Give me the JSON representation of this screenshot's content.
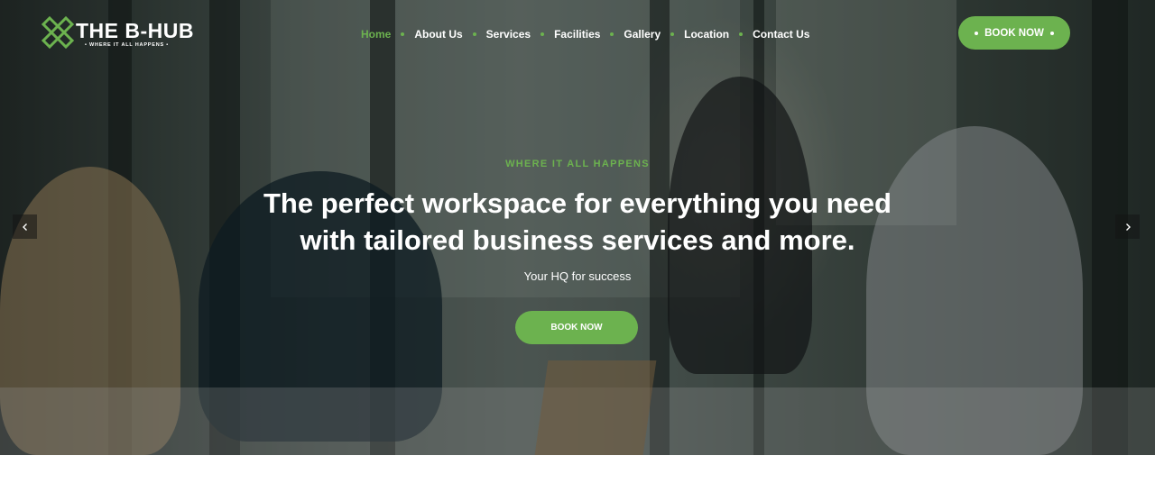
{
  "brand": {
    "name": "THE B-HUB",
    "tagline": "• WHERE IT ALL HAPPENS •",
    "accent_color": "#6cb24f"
  },
  "nav": {
    "items": [
      {
        "label": "Home",
        "active": true
      },
      {
        "label": "About Us",
        "active": false
      },
      {
        "label": "Services",
        "active": false
      },
      {
        "label": "Facilities",
        "active": false
      },
      {
        "label": "Gallery",
        "active": false
      },
      {
        "label": "Location",
        "active": false
      },
      {
        "label": "Contact Us",
        "active": false
      }
    ]
  },
  "header": {
    "book_label": "BOOK NOW"
  },
  "hero": {
    "eyebrow": "WHERE IT ALL HAPPENS",
    "headline_line1": "The perfect workspace for everything you need",
    "headline_line2": "with tailored business services and more.",
    "subline": "Your HQ for success",
    "cta_label": "BOOK NOW",
    "prev_icon": "chevron-left-icon",
    "next_icon": "chevron-right-icon"
  }
}
